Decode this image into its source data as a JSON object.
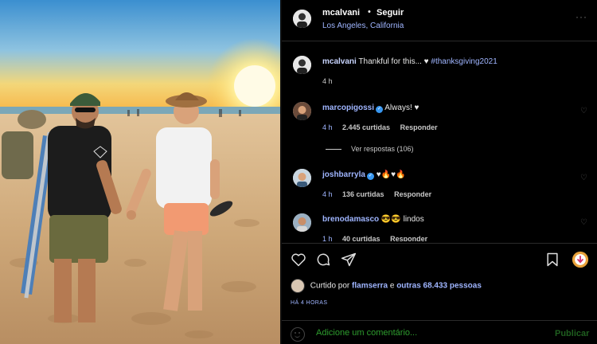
{
  "post": {
    "author": "mcalvani",
    "separator": "•",
    "follow_label": "Seguir",
    "location": "Los Angeles, California",
    "more_label": "···"
  },
  "caption": {
    "author": "mcalvani",
    "text": "Thankful for this... ♥ ",
    "hashtag": "#thanksgiving2021",
    "time": "4 h"
  },
  "comments": [
    {
      "user": "marcopigossi",
      "verified": true,
      "text": "Always! ♥",
      "time": "4 h",
      "likes": "2.445 curtidas",
      "reply_label": "Responder"
    },
    {
      "user": "joshbarryla",
      "verified": true,
      "text": "♥🔥♥🔥",
      "time": "4 h",
      "likes": "136 curtidas",
      "reply_label": "Responder"
    },
    {
      "user": "brenodamasco",
      "verified": false,
      "text": "😎😎 lindos",
      "time": "1 h",
      "likes": "40 curtidas",
      "reply_label": "Responder"
    }
  ],
  "view_replies": "Ver respostas (106)",
  "likes_line": {
    "prefix": "Curtido por",
    "user": "flamserra",
    "conj": "e",
    "others": "outras 68.433 pessoas"
  },
  "timestamp": "HÁ 4 HORAS",
  "add_comment": {
    "placeholder": "Adicione um comentário...",
    "publish_label": "Publicar"
  },
  "colors": {
    "link": "#9fb5ff",
    "verified": "#3897f0",
    "input_text": "#2e9d2e",
    "save_badge": "#e8a13a"
  },
  "icons": [
    "heart-icon",
    "comment-icon",
    "share-icon",
    "bookmark-icon",
    "emoji-icon",
    "more-icon"
  ]
}
